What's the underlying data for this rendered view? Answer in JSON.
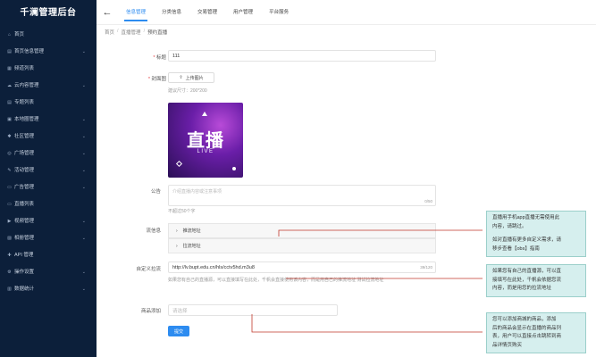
{
  "sidebar": {
    "brand": "千澜管理后台",
    "items": [
      {
        "icon": "home-icon",
        "glyph": "⌂",
        "label": "首页",
        "chevron": false
      },
      {
        "icon": "file-icon",
        "glyph": "▤",
        "label": "首页信息管理",
        "chevron": true
      },
      {
        "icon": "list-icon",
        "glyph": "▦",
        "label": "频道列表",
        "chevron": false
      },
      {
        "icon": "cloud-icon",
        "glyph": "☁",
        "label": "云内容管理",
        "chevron": true
      },
      {
        "icon": "topic-icon",
        "glyph": "▤",
        "label": "专题列表",
        "chevron": false
      },
      {
        "icon": "circle-icon",
        "glyph": "▣",
        "label": "本地圈管理",
        "chevron": true
      },
      {
        "icon": "community-icon",
        "glyph": "✱",
        "label": "社区管理",
        "chevron": true
      },
      {
        "icon": "broadcast-icon",
        "glyph": "◎",
        "label": "广场管理",
        "chevron": true
      },
      {
        "icon": "activity-icon",
        "glyph": "✎",
        "label": "活动管理",
        "chevron": true
      },
      {
        "icon": "ad-icon",
        "glyph": "▭",
        "label": "广告管理",
        "chevron": true
      },
      {
        "icon": "live-icon",
        "glyph": "▭",
        "label": "直播列表",
        "chevron": false
      },
      {
        "icon": "video-icon",
        "glyph": "▶",
        "label": "视频管理",
        "chevron": true
      },
      {
        "icon": "image-icon",
        "glyph": "▨",
        "label": "相册管理",
        "chevron": true
      },
      {
        "icon": "api-icon",
        "glyph": "✚",
        "label": "API 管理",
        "chevron": false
      },
      {
        "icon": "settings-icon",
        "glyph": "⚙",
        "label": "操作设置",
        "chevron": true
      },
      {
        "icon": "stats-icon",
        "glyph": "▥",
        "label": "数据统计",
        "chevron": true
      }
    ]
  },
  "topbar": {
    "tabs": [
      {
        "label": "信息管理",
        "active": true
      },
      {
        "label": "分类信息",
        "active": false
      },
      {
        "label": "交易管理",
        "active": false
      },
      {
        "label": "用户管理",
        "active": false
      },
      {
        "label": "平台服务",
        "active": false
      }
    ]
  },
  "breadcrumb": [
    "首页",
    "直播管理",
    "预约直播"
  ],
  "form": {
    "title_label": "标题",
    "title_value": "111",
    "cover_label": "封面图",
    "upload_label": "上传图片",
    "cover_hint": "建议尺寸：200*200",
    "poster_title": "直播",
    "poster_sub": "LIVE",
    "notice_label": "公告",
    "notice_placeholder": "介绍直播内容或注意事项",
    "notice_count": "0/50",
    "notice_hint": "不超过50个字",
    "stream_label": "流信息",
    "stream_items": [
      "推流地址",
      "拉流地址"
    ],
    "custom_label": "自定义拉流",
    "custom_value": "http://lv.bupt.edu.cn/hls/cctv5hd.m3u8",
    "custom_count": "39/120",
    "custom_hint": "如果您有自己的直播源，可以直接填写在此处，千帆会直接使用该内容，而是用自己的推流地址 测试拉流地址",
    "goods_label": "商品添加",
    "goods_placeholder": "请选择",
    "submit_label": "提交"
  },
  "notes": [
    {
      "lines": [
        "直播用手机app直播无需使用此",
        "内容，请跳过。",
        "",
        "如对直播有更多自定义需求，请",
        "移步查看【obs】指南"
      ]
    },
    {
      "lines": [
        "如果您有自己的直播源，可以直",
        "接填写在此处，千帆会依据您流",
        "内容，而是用您的拉流地址"
      ]
    },
    {
      "lines": [
        "您可以添加商城的商品，添加",
        "后的商品会显示在直播的商品列",
        "表，用户可以直接点击跳转到商",
        "品详情页购买"
      ]
    }
  ],
  "colors": {
    "sidebar_bg": "#0c1f3a",
    "accent": "#2d8cf0",
    "note_bg": "#d6efee",
    "callout": "#c0392b"
  }
}
